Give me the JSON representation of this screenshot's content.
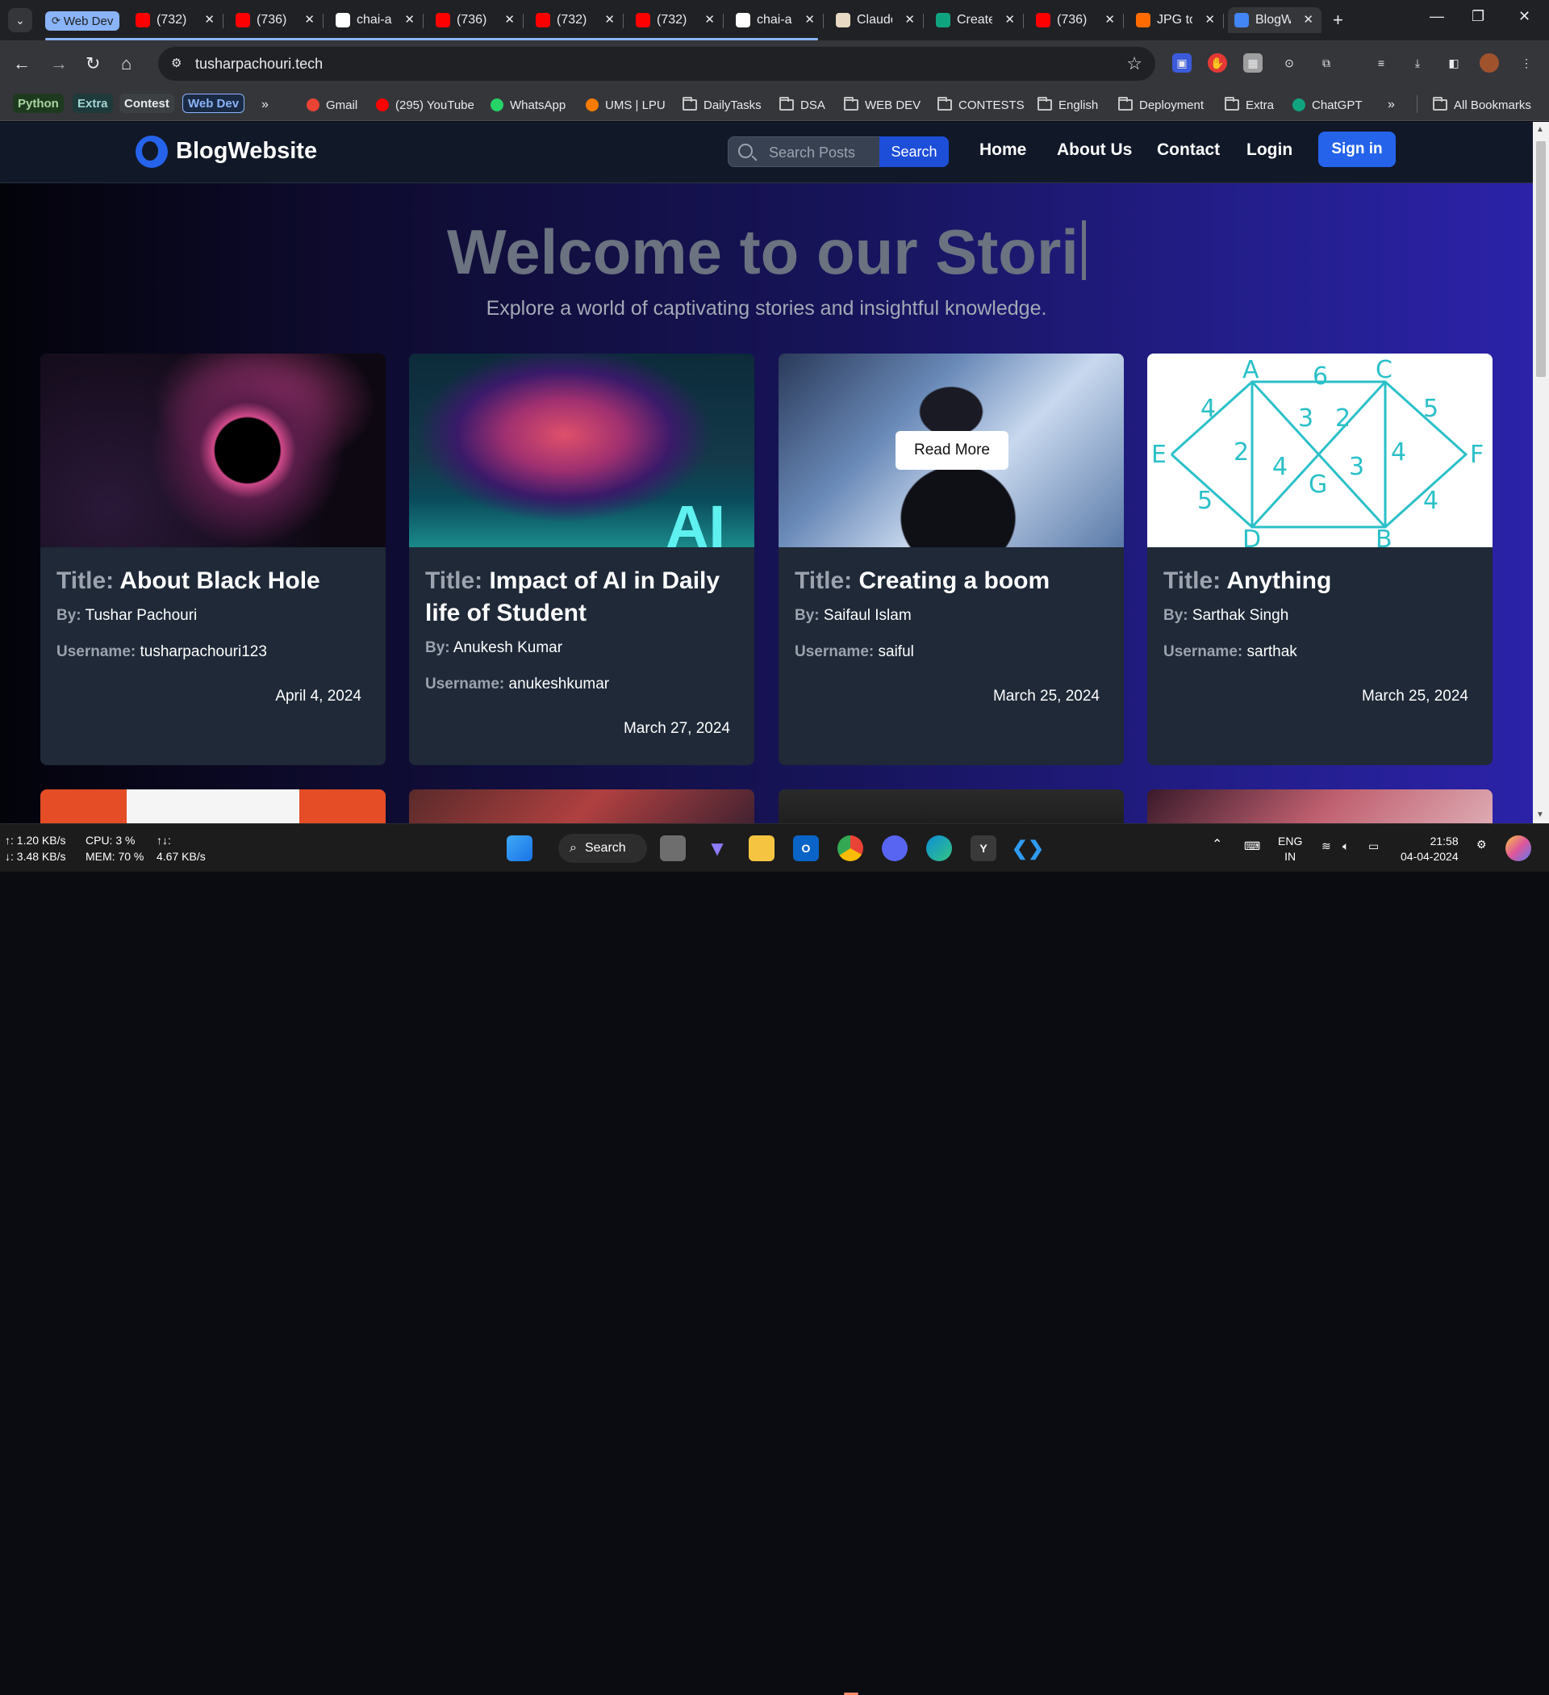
{
  "browser": {
    "tab_group": {
      "label": "Web Dev",
      "color": "#8ab4f8"
    },
    "tabs": [
      {
        "title": "(732)",
        "icon": "record-icon",
        "color": "#ff0000"
      },
      {
        "title": "(736)",
        "icon": "youtube-icon",
        "color": "#ff0000"
      },
      {
        "title": "chai-aur",
        "icon": "github-icon",
        "color": "#ffffff"
      },
      {
        "title": "(736)",
        "icon": "youtube-icon",
        "color": "#ff0000"
      },
      {
        "title": "(732)",
        "icon": "youtube-icon",
        "color": "#ff0000"
      },
      {
        "title": "(732)",
        "icon": "youtube-icon",
        "color": "#ff0000"
      },
      {
        "title": "chai-aur",
        "icon": "github-icon",
        "color": "#ffffff"
      },
      {
        "title": "Claude",
        "icon": "claude-icon",
        "color": "#e8d9c4"
      },
      {
        "title": "Create",
        "icon": "chatgpt-icon",
        "color": "#10a37f"
      },
      {
        "title": "(736)",
        "icon": "youtube-icon",
        "color": "#ff0000"
      },
      {
        "title": "JPG to",
        "icon": "converter-icon",
        "color": "#ff6b00"
      },
      {
        "title": "BlogWebsite",
        "icon": "blog-icon",
        "color": "#4285f4",
        "active": true
      }
    ],
    "url": "tusharpachouri.tech",
    "bookmarks_chips": [
      {
        "label": "Python",
        "bg": "#1e3a1e",
        "fg": "#a8d5a2"
      },
      {
        "label": "Extra",
        "bg": "#1e3a3a",
        "fg": "#a2d5d5"
      },
      {
        "label": "Contest",
        "bg": "#3c4043",
        "fg": "#e8eaed"
      },
      {
        "label": "Web Dev",
        "bg": "#1a2a44",
        "fg": "#8ab4f8"
      }
    ],
    "bookmarks": [
      {
        "label": "Gmail",
        "icon": "gmail-icon"
      },
      {
        "label": "(295) YouTube",
        "icon": "youtube-icon"
      },
      {
        "label": "WhatsApp",
        "icon": "whatsapp-icon"
      },
      {
        "label": "UMS | LPU",
        "icon": "lpu-icon"
      },
      {
        "label": "DailyTasks",
        "icon": "folder-icon"
      },
      {
        "label": "DSA",
        "icon": "folder-icon"
      },
      {
        "label": "WEB DEV",
        "icon": "folder-icon"
      },
      {
        "label": "CONTESTS",
        "icon": "folder-icon"
      },
      {
        "label": "English",
        "icon": "folder-icon"
      },
      {
        "label": "Deployment",
        "icon": "folder-icon"
      },
      {
        "label": "Extra",
        "icon": "folder-icon"
      },
      {
        "label": "ChatGPT",
        "icon": "chatgpt-icon"
      }
    ],
    "all_bookmarks": "All Bookmarks"
  },
  "site": {
    "brand": "BlogWebsite",
    "search_placeholder": "Search Posts",
    "search_button": "Search",
    "nav": [
      "Home",
      "About Us",
      "Contact",
      "Login"
    ],
    "signin": "Sign in",
    "hero_title": "Welcome to our Stori",
    "hero_subtitle": "Explore a world of captivating stories and insightful knowledge.",
    "title_label": "Title:",
    "by_label": "By:",
    "username_label": "Username:",
    "read_more": "Read More",
    "posts": [
      {
        "title": "About Black Hole",
        "author": "Tushar Pachouri",
        "username": "tusharpachouri123",
        "date": "April 4, 2024"
      },
      {
        "title": "Impact of AI in Daily life of Student",
        "author": "Anukesh Kumar",
        "username": "anukeshkumar",
        "date": "March 27, 2024"
      },
      {
        "title": "Creating a boom",
        "author": "Saifaul Islam",
        "username": "saiful",
        "date": "March 25, 2024"
      },
      {
        "title": "Anything",
        "author": "Sarthak Singh",
        "username": "sarthak",
        "date": "March 25, 2024"
      }
    ],
    "ai_image_text": "AI",
    "graph_nodes": [
      "A",
      "C",
      "E",
      "F",
      "D",
      "B",
      "G"
    ],
    "graph_weights": [
      "4",
      "6",
      "5",
      "3",
      "2",
      "2",
      "4",
      "3",
      "4",
      "5",
      "4"
    ]
  },
  "taskbar": {
    "net_up": "↑: 1.20 KB/s",
    "net_down": "↓: 3.48 KB/s",
    "cpu": "CPU: 3 %",
    "mem": "MEM: 70 %",
    "updown_label": "↑↓:",
    "updown_value": "4.67 KB/s",
    "search": "Search",
    "lang_top": "ENG",
    "lang_bottom": "IN",
    "time": "21:58",
    "date": "04-04-2024"
  }
}
